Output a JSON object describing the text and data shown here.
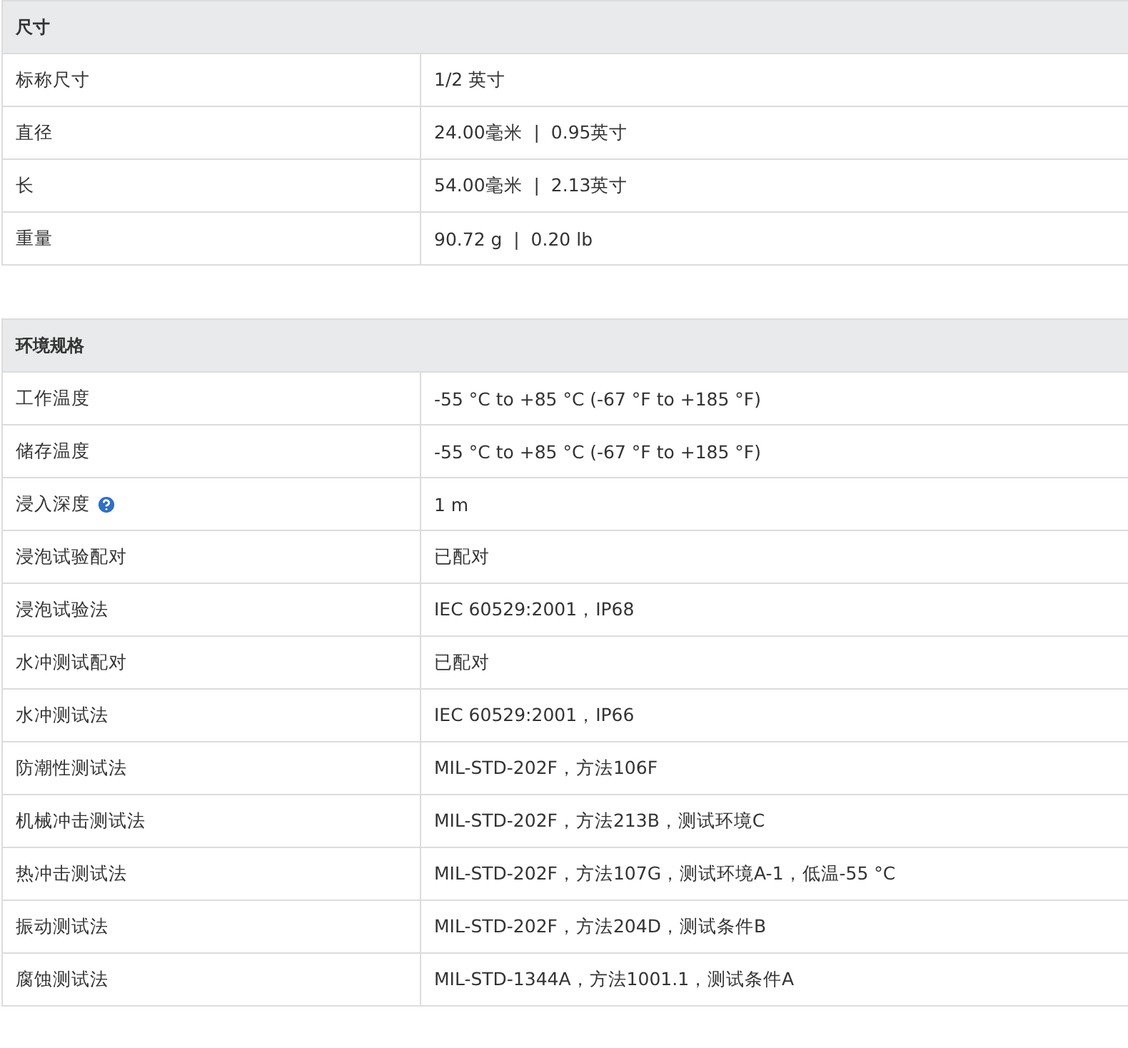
{
  "sections": [
    {
      "title": "尺寸",
      "rows": [
        {
          "label": "标称尺寸",
          "value": "1/2 英寸"
        },
        {
          "label": "直径",
          "value": "24.00毫米  |  0.95英寸"
        },
        {
          "label": "长",
          "value": "54.00毫米  |  2.13英寸"
        },
        {
          "label": "重量",
          "value": "90.72 g  |  0.20 lb"
        }
      ]
    },
    {
      "title": "环境规格",
      "rows": [
        {
          "label": "工作温度",
          "value": "-55 °C to +85 °C (-67 °F to +185 °F)"
        },
        {
          "label": "储存温度",
          "value": "-55 °C to +85 °C (-67 °F to +185 °F)"
        },
        {
          "label": "浸入深度",
          "value": "1 m",
          "help": true
        },
        {
          "label": "浸泡试验配对",
          "value": "已配对"
        },
        {
          "label": "浸泡试验法",
          "value": "IEC 60529:2001，IP68"
        },
        {
          "label": "水冲测试配对",
          "value": "已配对"
        },
        {
          "label": "水冲测试法",
          "value": "IEC 60529:2001，IP66"
        },
        {
          "label": "防潮性测试法",
          "value": "MIL-STD-202F，方法106F"
        },
        {
          "label": "机械冲击测试法",
          "value": "MIL-STD-202F，方法213B，测试环境C"
        },
        {
          "label": "热冲击测试法",
          "value": "MIL-STD-202F，方法107G，测试环境A-1，低温-55 °C"
        },
        {
          "label": "振动测试法",
          "value": "MIL-STD-202F，方法204D，测试条件B"
        },
        {
          "label": "腐蚀测试法",
          "value": "MIL-STD-1344A，方法1001.1，测试条件A"
        }
      ]
    }
  ]
}
